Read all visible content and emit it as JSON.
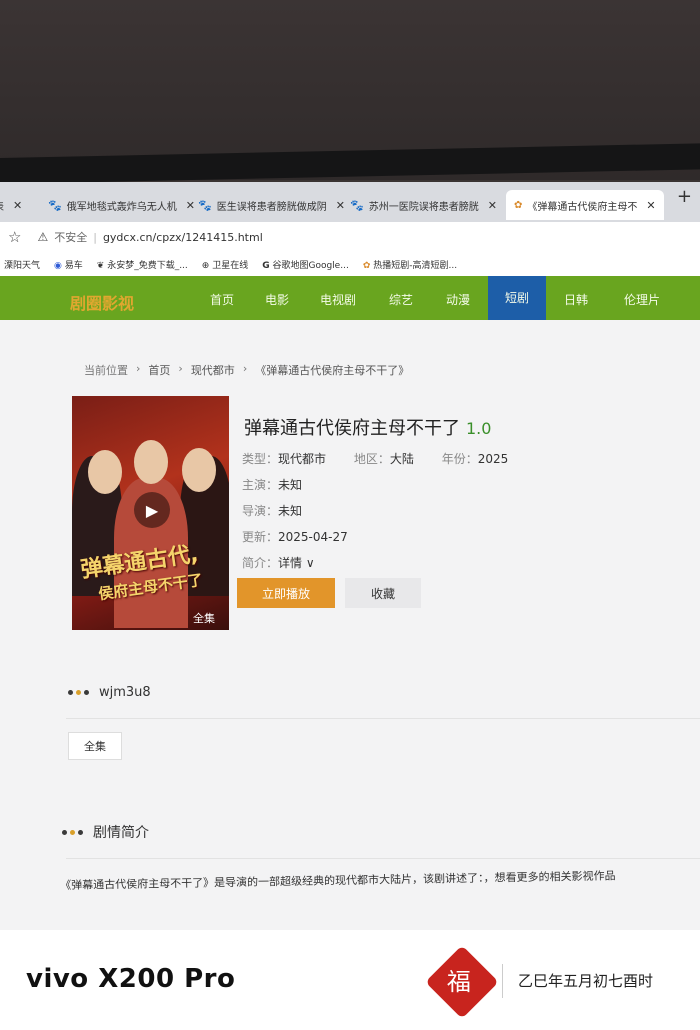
{
  "browser": {
    "tabs": [
      {
        "label": "表"
      },
      {
        "label": "俄军地毯式轰炸乌无人机"
      },
      {
        "label": "医生误将患者膀胱做成阴"
      },
      {
        "label": "苏州一医院误将患者膀胱"
      },
      {
        "label": "《弹幕通古代侯府主母不"
      }
    ],
    "new_tab": "+",
    "security_label": "不安全",
    "url": "gydcx.cn/cpzx/1241415.html",
    "bookmarks": [
      "溧阳天气",
      "易车",
      "永安梦_免费下载_...",
      "卫星在线",
      "谷歌地图Google...",
      "热播短剧-高清短剧..."
    ]
  },
  "site": {
    "logo": "剧圈影视",
    "nav": [
      "首页",
      "电影",
      "电视剧",
      "综艺",
      "动漫",
      "短剧",
      "日韩",
      "伦理片"
    ],
    "active_nav": "短剧"
  },
  "breadcrumb": {
    "prefix": "当前位置",
    "home": "首页",
    "category": "现代都市",
    "current": "《弹幕通古代侯府主母不干了》"
  },
  "poster": {
    "title_line1": "弹幕通古代,",
    "title_line2": "侯府主母不干了",
    "badge": "全集"
  },
  "detail": {
    "title": "弹幕通古代侯府主母不干了",
    "score": "1.0",
    "type_label": "类型：",
    "type_value": "现代都市",
    "region_label": "地区：",
    "region_value": "大陆",
    "year_label": "年份：",
    "year_value": "2025",
    "cast_label": "主演：",
    "cast_value": "未知",
    "director_label": "导演：",
    "director_value": "未知",
    "updated_label": "更新：",
    "updated_value": "2025-04-27",
    "intro_label": "简介：",
    "intro_value": "详情 ∨",
    "play_button": "立即播放",
    "fav_button": "收藏"
  },
  "source": {
    "name": "wjm3u8",
    "episode": "全集"
  },
  "synopsis": {
    "heading": "剧情简介",
    "text": "《弹幕通古代侯府主母不干了》是导演的一部超级经典的现代都市大陆片，该剧讲述了：，想看更多的相关影视作品"
  },
  "watermark": {
    "brand": "vivo X200 Pro",
    "seal": "福",
    "lunar": "乙巳年五月初七酉时"
  },
  "colors": {
    "nav_bg": "#69a51f",
    "nav_active": "#1d5ea8",
    "play_btn": "#e2952a",
    "score": "#3a8f2a"
  }
}
